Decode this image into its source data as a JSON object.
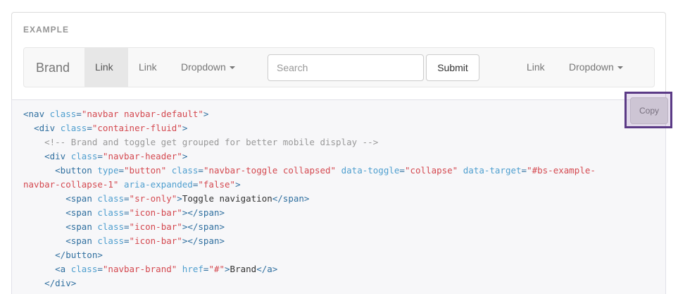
{
  "example": {
    "label": "EXAMPLE"
  },
  "navbar": {
    "brand": "Brand",
    "left_items": [
      {
        "label": "Link"
      },
      {
        "label": "Link"
      },
      {
        "label": "Dropdown"
      }
    ],
    "search": {
      "placeholder": "Search",
      "value": ""
    },
    "submit_label": "Submit",
    "right_items": [
      {
        "label": "Link"
      },
      {
        "label": "Dropdown"
      }
    ]
  },
  "copy_button": {
    "label": "Copy"
  },
  "code": {
    "lines": [
      [
        {
          "t": "tag",
          "v": "<nav "
        },
        {
          "t": "attr",
          "v": "class"
        },
        {
          "t": "tag",
          "v": "="
        },
        {
          "t": "val",
          "v": "\"navbar navbar-default\""
        },
        {
          "t": "tag",
          "v": ">"
        }
      ],
      [
        {
          "t": "txt",
          "v": "  "
        },
        {
          "t": "tag",
          "v": "<div "
        },
        {
          "t": "attr",
          "v": "class"
        },
        {
          "t": "tag",
          "v": "="
        },
        {
          "t": "val",
          "v": "\"container-fluid\""
        },
        {
          "t": "tag",
          "v": ">"
        }
      ],
      [
        {
          "t": "txt",
          "v": "    "
        },
        {
          "t": "cmt",
          "v": "<!-- Brand and toggle get grouped for better mobile display -->"
        }
      ],
      [
        {
          "t": "txt",
          "v": "    "
        },
        {
          "t": "tag",
          "v": "<div "
        },
        {
          "t": "attr",
          "v": "class"
        },
        {
          "t": "tag",
          "v": "="
        },
        {
          "t": "val",
          "v": "\"navbar-header\""
        },
        {
          "t": "tag",
          "v": ">"
        }
      ],
      [
        {
          "t": "txt",
          "v": "      "
        },
        {
          "t": "tag",
          "v": "<button "
        },
        {
          "t": "attr",
          "v": "type"
        },
        {
          "t": "tag",
          "v": "="
        },
        {
          "t": "val",
          "v": "\"button\""
        },
        {
          "t": "txt",
          "v": " "
        },
        {
          "t": "attr",
          "v": "class"
        },
        {
          "t": "tag",
          "v": "="
        },
        {
          "t": "val",
          "v": "\"navbar-toggle collapsed\""
        },
        {
          "t": "txt",
          "v": " "
        },
        {
          "t": "attr",
          "v": "data-toggle"
        },
        {
          "t": "tag",
          "v": "="
        },
        {
          "t": "val",
          "v": "\"collapse\""
        },
        {
          "t": "txt",
          "v": " "
        },
        {
          "t": "attr",
          "v": "data-target"
        },
        {
          "t": "tag",
          "v": "="
        },
        {
          "t": "val",
          "v": "\"#bs-example-"
        }
      ],
      [
        {
          "t": "val",
          "v": "navbar-collapse-1\""
        },
        {
          "t": "txt",
          "v": " "
        },
        {
          "t": "attr",
          "v": "aria-expanded"
        },
        {
          "t": "tag",
          "v": "="
        },
        {
          "t": "val",
          "v": "\"false\""
        },
        {
          "t": "tag",
          "v": ">"
        }
      ],
      [
        {
          "t": "txt",
          "v": "        "
        },
        {
          "t": "tag",
          "v": "<span "
        },
        {
          "t": "attr",
          "v": "class"
        },
        {
          "t": "tag",
          "v": "="
        },
        {
          "t": "val",
          "v": "\"sr-only\""
        },
        {
          "t": "tag",
          "v": ">"
        },
        {
          "t": "txt",
          "v": "Toggle navigation"
        },
        {
          "t": "tag",
          "v": "</span>"
        }
      ],
      [
        {
          "t": "txt",
          "v": "        "
        },
        {
          "t": "tag",
          "v": "<span "
        },
        {
          "t": "attr",
          "v": "class"
        },
        {
          "t": "tag",
          "v": "="
        },
        {
          "t": "val",
          "v": "\"icon-bar\""
        },
        {
          "t": "tag",
          "v": "></span>"
        }
      ],
      [
        {
          "t": "txt",
          "v": "        "
        },
        {
          "t": "tag",
          "v": "<span "
        },
        {
          "t": "attr",
          "v": "class"
        },
        {
          "t": "tag",
          "v": "="
        },
        {
          "t": "val",
          "v": "\"icon-bar\""
        },
        {
          "t": "tag",
          "v": "></span>"
        }
      ],
      [
        {
          "t": "txt",
          "v": "        "
        },
        {
          "t": "tag",
          "v": "<span "
        },
        {
          "t": "attr",
          "v": "class"
        },
        {
          "t": "tag",
          "v": "="
        },
        {
          "t": "val",
          "v": "\"icon-bar\""
        },
        {
          "t": "tag",
          "v": "></span>"
        }
      ],
      [
        {
          "t": "txt",
          "v": "      "
        },
        {
          "t": "tag",
          "v": "</button>"
        }
      ],
      [
        {
          "t": "txt",
          "v": "      "
        },
        {
          "t": "tag",
          "v": "<a "
        },
        {
          "t": "attr",
          "v": "class"
        },
        {
          "t": "tag",
          "v": "="
        },
        {
          "t": "val",
          "v": "\"navbar-brand\""
        },
        {
          "t": "txt",
          "v": " "
        },
        {
          "t": "attr",
          "v": "href"
        },
        {
          "t": "tag",
          "v": "="
        },
        {
          "t": "val",
          "v": "\"#\""
        },
        {
          "t": "tag",
          "v": ">"
        },
        {
          "t": "txt",
          "v": "Brand"
        },
        {
          "t": "tag",
          "v": "</a>"
        }
      ],
      [
        {
          "t": "txt",
          "v": "    "
        },
        {
          "t": "tag",
          "v": "</div>"
        }
      ]
    ]
  }
}
